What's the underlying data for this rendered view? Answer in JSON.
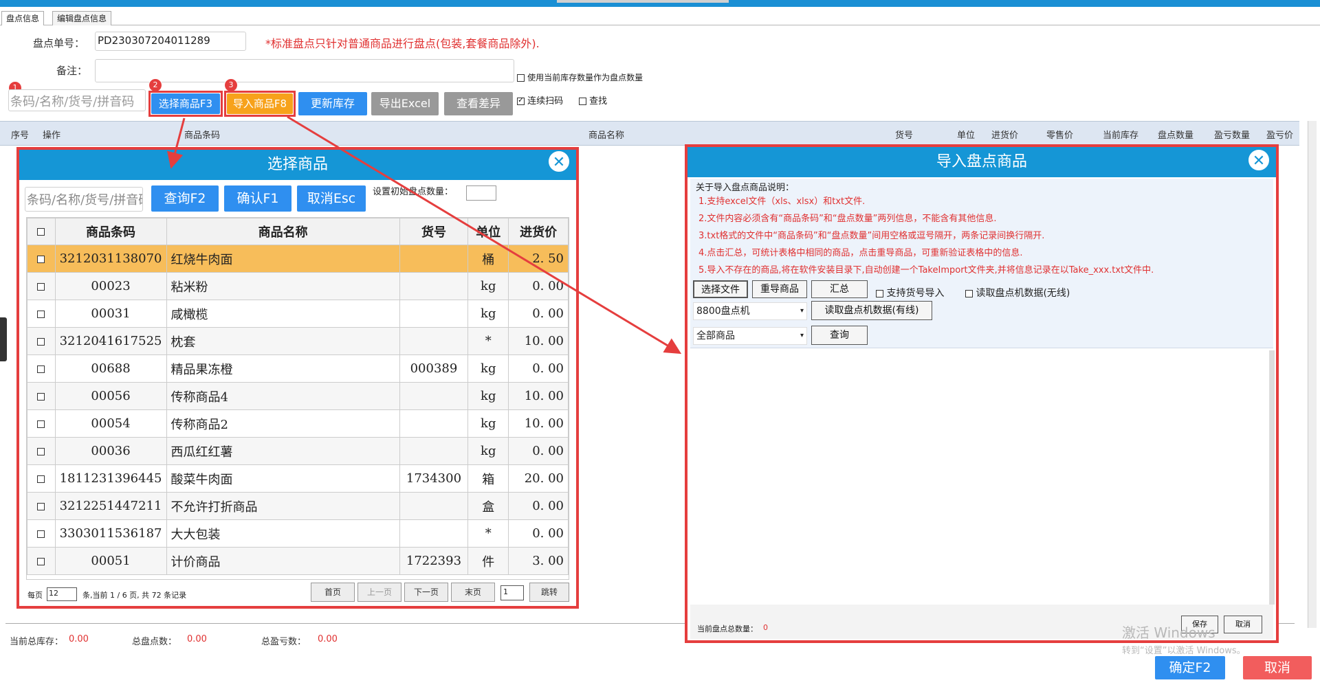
{
  "tabs": [
    "盘点信息",
    "编辑盘点信息"
  ],
  "form": {
    "order_label": "盘点单号：",
    "order_value": "PD230307204011289",
    "notice": "*标准盘点只针对普通商品进行盘点(包装,套餐商品除外).",
    "remark_label": "备注：",
    "use_stock_label": "使用当前库存数量作为盘点数量",
    "search_placeholder": "条码/名称/货号/拼音码",
    "badges": [
      "1",
      "2",
      "3"
    ]
  },
  "toolbar": {
    "select_goods": "选择商品F3",
    "import_goods": "导入商品F8",
    "update_stock": "更新库存",
    "export_excel": "导出Excel",
    "view_diff": "查看差异",
    "continuous_scan": "连续扫码",
    "find": "查找"
  },
  "grid_headers": [
    "序号",
    "操作",
    "商品条码",
    "商品名称",
    "货号",
    "单位",
    "进货价",
    "零售价",
    "当前库存",
    "盘点数量",
    "盈亏数量",
    "盈亏价"
  ],
  "summary": {
    "stock_label": "当前总库存：",
    "stock_value": "0.00",
    "count_label": "总盘点数：",
    "count_value": "0.00",
    "profit_label": "总盈亏数：",
    "profit_value": "0.00"
  },
  "select_panel": {
    "title": "选择商品",
    "search_placeholder": "条码/名称/货号/拼音码",
    "query_btn": "查询F2",
    "confirm_btn": "确认F1",
    "cancel_btn": "取消Esc",
    "init_count_label": "设置初始盘点数量：",
    "columns": [
      "商品条码",
      "商品名称",
      "货号",
      "单位",
      "进货价"
    ],
    "rows": [
      [
        "3212031138070",
        "红烧牛肉面",
        "",
        "桶",
        "2. 50"
      ],
      [
        "00023",
        "粘米粉",
        "",
        "kg",
        "0. 00"
      ],
      [
        "00031",
        "咸橄榄",
        "",
        "kg",
        "0. 00"
      ],
      [
        "3212041617525",
        "枕套",
        "",
        "*",
        "10. 00"
      ],
      [
        "00688",
        "精品果冻橙",
        "000389",
        "kg",
        "0. 00"
      ],
      [
        "00056",
        "传称商品4",
        "",
        "kg",
        "10. 00"
      ],
      [
        "00054",
        "传称商品2",
        "",
        "kg",
        "10. 00"
      ],
      [
        "00036",
        "西瓜红红薯",
        "",
        "kg",
        "0. 00"
      ],
      [
        "1811231396445",
        "酸菜牛肉面",
        "1734300",
        "箱",
        "20. 00"
      ],
      [
        "3212251447211",
        "不允许打折商品",
        "",
        "盒",
        "0. 00"
      ],
      [
        "3303011536187",
        "大大包装",
        "",
        "*",
        "0. 00"
      ],
      [
        "00051",
        "计价商品",
        "1722393",
        "件",
        "3. 00"
      ]
    ],
    "per_page_label": "每页",
    "per_page_value": "12",
    "page_info": "条,当前 1 / 6 页, 共 72 条记录",
    "first": "首页",
    "prev": "上一页",
    "next": "下一页",
    "last": "末页",
    "page_input": "1",
    "jump": "跳转"
  },
  "import_panel": {
    "title": "导入盘点商品",
    "about": "关于导入盘点商品说明：",
    "lines": [
      "1.支持excel文件（xls、xlsx）和txt文件.",
      "2.文件内容必须含有“商品条码”和“盘点数量”两列信息，不能含有其他信息.",
      "3.txt格式的文件中“商品条码”和“盘点数量”间用空格或逗号隔开，两条记录间换行隔开.",
      "4.点击汇总，可统计表格中相同的商品，点击重导商品，可重新验证表格中的信息.",
      "5.导入不存在的商品,将在软件安装目录下,自动创建一个TakeImport文件夹,并将信息记录在以Take_xxx.txt文件中."
    ],
    "choose_file": "选择文件",
    "reimport": "重导商品",
    "summary": "汇总",
    "support_code": "支持货号导入",
    "read_wireless": "读取盘点机数据(无线)",
    "device": "8800盘点机",
    "read_wired": "读取盘点机数据(有线)",
    "filter": "全部商品",
    "query": "查询",
    "total_label": "当前盘点总数量：",
    "total_value": "0",
    "save": "保存",
    "cancel": "取消"
  },
  "watermark": {
    "line1": "激活 Windows",
    "line2": "转到“设置”以激活 Windows。"
  },
  "footer": {
    "confirm": "确定F2",
    "cancel": "取消"
  },
  "colors": {
    "accent": "#2f8ff0",
    "title_bar": "#1596d6",
    "highlight": "#e53e3e",
    "selected_row": "#f7bd5a"
  }
}
